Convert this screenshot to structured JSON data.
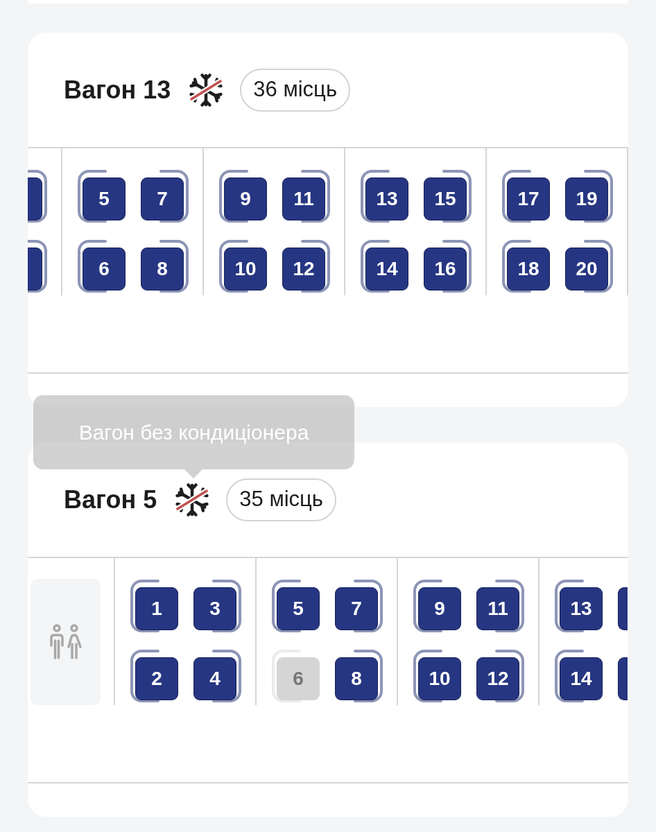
{
  "cars": [
    {
      "title": "Вагон 13",
      "air_conditioning": false,
      "seat_count": "36 місць",
      "compartments": [
        {
          "kind": "seats",
          "cut_off_left": true,
          "seats": [
            {
              "available": true
            },
            {
              "available": true
            }
          ]
        },
        {
          "kind": "seats",
          "seats": [
            {
              "number": "5",
              "available": true
            },
            {
              "number": "6",
              "available": true
            },
            {
              "number": "7",
              "available": true
            },
            {
              "number": "8",
              "available": true
            }
          ]
        },
        {
          "kind": "seats",
          "seats": [
            {
              "number": "9",
              "available": true
            },
            {
              "number": "10",
              "available": true
            },
            {
              "number": "11",
              "available": true
            },
            {
              "number": "12",
              "available": true
            }
          ]
        },
        {
          "kind": "seats",
          "seats": [
            {
              "number": "13",
              "available": true
            },
            {
              "number": "14",
              "available": true
            },
            {
              "number": "15",
              "available": true
            },
            {
              "number": "16",
              "available": true
            }
          ]
        },
        {
          "kind": "seats",
          "seats": [
            {
              "number": "17",
              "available": true
            },
            {
              "number": "18",
              "available": true
            },
            {
              "number": "19",
              "available": true
            },
            {
              "number": "20",
              "available": true
            }
          ]
        }
      ]
    },
    {
      "title": "Вагон 5",
      "air_conditioning": false,
      "seat_count": "35 місць",
      "tooltip": "Вагон без кондиціонера",
      "compartments": [
        {
          "kind": "toilet"
        },
        {
          "kind": "seats",
          "seats": [
            {
              "number": "1",
              "available": true
            },
            {
              "number": "2",
              "available": true
            },
            {
              "number": "3",
              "available": true
            },
            {
              "number": "4",
              "available": true
            }
          ]
        },
        {
          "kind": "seats",
          "seats": [
            {
              "number": "5",
              "available": true
            },
            {
              "number": "6",
              "available": false
            },
            {
              "number": "7",
              "available": true
            },
            {
              "number": "8",
              "available": true
            }
          ]
        },
        {
          "kind": "seats",
          "seats": [
            {
              "number": "9",
              "available": true
            },
            {
              "number": "10",
              "available": true
            },
            {
              "number": "11",
              "available": true
            },
            {
              "number": "12",
              "available": true
            }
          ]
        },
        {
          "kind": "seats",
          "cut_off_right": true,
          "seats": [
            {
              "number": "13",
              "available": true
            },
            {
              "number": "14",
              "available": true
            },
            {
              "available": true
            },
            {
              "available": true
            }
          ]
        }
      ]
    }
  ]
}
